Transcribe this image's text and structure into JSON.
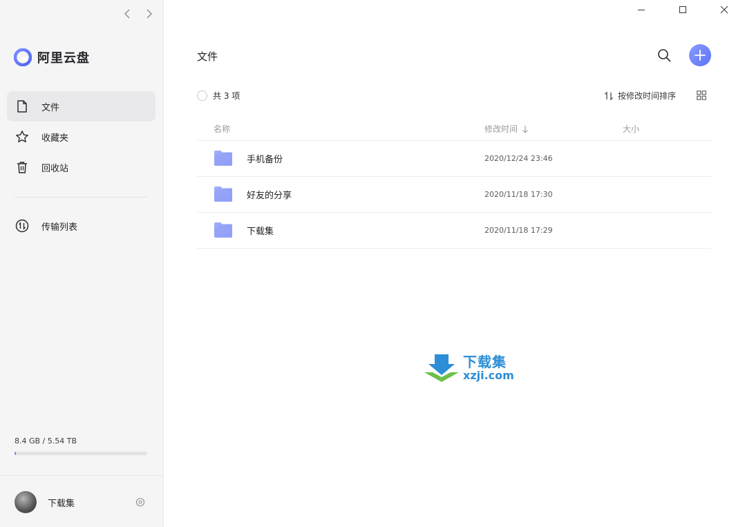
{
  "app": {
    "name": "阿里云盘"
  },
  "sidebar": {
    "items": [
      {
        "label": "文件",
        "icon": "file-icon",
        "active": true
      },
      {
        "label": "收藏夹",
        "icon": "star-icon",
        "active": false
      },
      {
        "label": "回收站",
        "icon": "trash-icon",
        "active": false
      }
    ],
    "transfer": {
      "label": "传输列表",
      "icon": "transfer-icon"
    },
    "storage": {
      "text": "8.4 GB / 5.54 TB",
      "used_fraction": 0.0015
    },
    "user": {
      "name": "下载集"
    }
  },
  "main": {
    "title": "文件",
    "count_text": "共 3 项",
    "sort_label": "按修改时间排序",
    "columns": {
      "name": "名称",
      "time": "修改时间",
      "size": "大小"
    },
    "files": [
      {
        "name": "手机备份",
        "time": "2020/12/24 23:46",
        "size": ""
      },
      {
        "name": "好友的分享",
        "time": "2020/11/18 17:30",
        "size": ""
      },
      {
        "name": "下载集",
        "time": "2020/11/18 17:29",
        "size": ""
      }
    ]
  },
  "watermark": {
    "title": "下载集",
    "site": "xzji.com"
  },
  "colors": {
    "accent": "#637dff",
    "folder": "#8b9bf5",
    "watermark": "#2c8ed6"
  }
}
